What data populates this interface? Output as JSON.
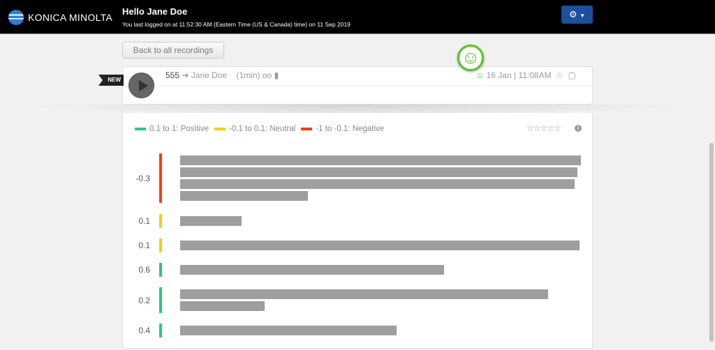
{
  "header": {
    "brand": "KONICA MINOLTA",
    "greeting": "Hello Jane Doe",
    "last_login": "You last logged on at 11:52:30 AM (Eastern Time (US & Canada) time) on 11 Sep 2019",
    "settings_icon": "gear-icon"
  },
  "back_button": "Back to all recordings",
  "recording": {
    "badge": "NEW",
    "from": "555",
    "arrow": "➔",
    "to": "Jane Doe",
    "duration": "(1min)",
    "date": "16 Jan | 11:08AM",
    "sentiment_icon": "smiley-icon"
  },
  "colors": {
    "positive": "#1fcf7e",
    "neutral": "#ffcc00",
    "negative": "#ff3a12",
    "accent": "#58c322"
  },
  "legend": [
    {
      "label": "0.1 to 1: Positive",
      "color": "#1fcf7e"
    },
    {
      "label": "-0.1 to 0.1: Neutral",
      "color": "#ffcc00"
    },
    {
      "label": "-1 to -0.1: Negative",
      "color": "#ff3a12"
    }
  ],
  "rating": {
    "stars": 0,
    "max": 5
  },
  "segments": [
    {
      "score": "-0.3",
      "sentiment": "negative"
    },
    {
      "score": "0.1",
      "sentiment": "neutral"
    },
    {
      "score": "0.1",
      "sentiment": "neutral"
    },
    {
      "score": "0.6",
      "sentiment": "positive"
    },
    {
      "score": "0.2",
      "sentiment": "positive"
    },
    {
      "score": "0.4",
      "sentiment": "positive"
    }
  ]
}
